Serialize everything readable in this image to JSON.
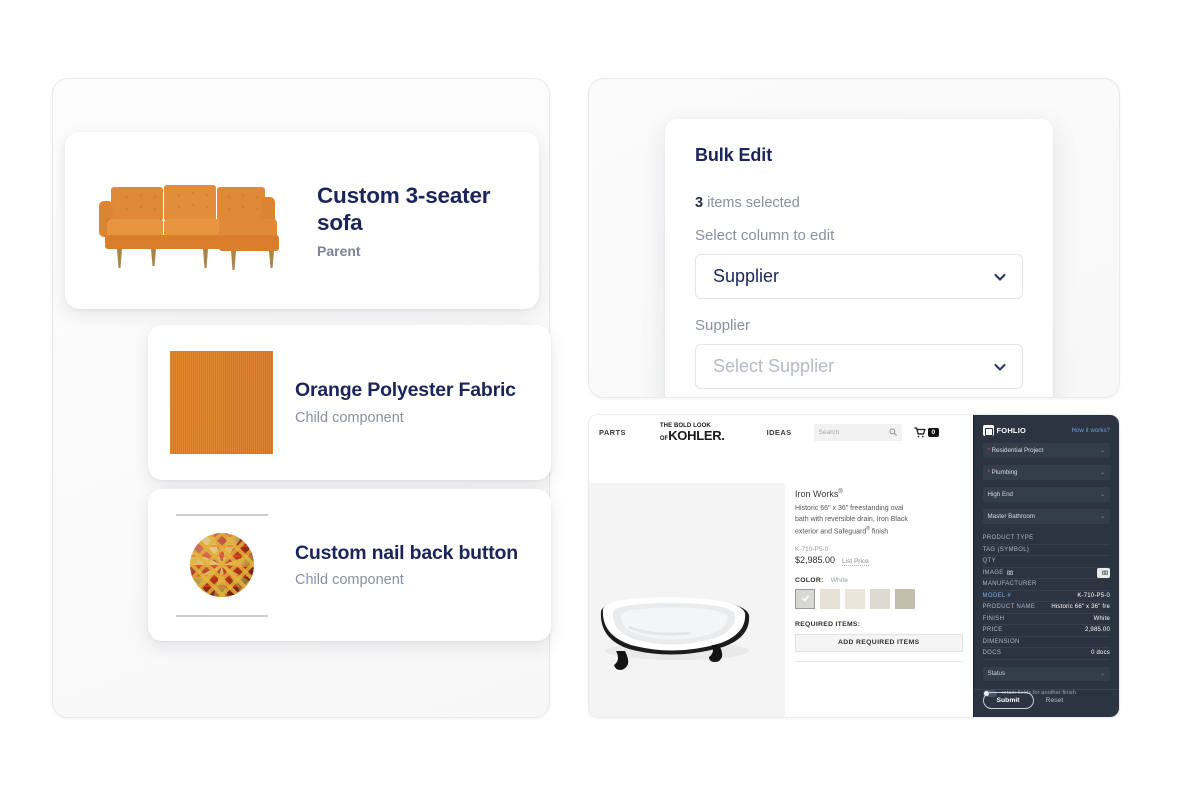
{
  "left_panel": {
    "cards": [
      {
        "title": "Custom 3-seater sofa",
        "subtitle": "Parent",
        "thumb": "sofa-image"
      },
      {
        "title": "Orange Polyester Fabric",
        "subtitle": "Child component",
        "thumb": "orange-fabric-swatch"
      },
      {
        "title": "Custom nail back button",
        "subtitle": "Child component",
        "thumb": "nail-button-image"
      }
    ]
  },
  "bulk_edit": {
    "title": "Bulk Edit",
    "count": "3",
    "count_suffix": " items selected",
    "column_label": "Select column to edit",
    "column_value": "Supplier",
    "supplier_label": "Supplier",
    "supplier_placeholder": "Select Supplier",
    "chevron_icon": "chevron-down-icon"
  },
  "kohler_shot": {
    "nav": {
      "parts": "PARTS",
      "logo_line1": "THE BOLD LOOK",
      "logo_line2_prefix": "OF",
      "logo_line2_brand": "KOHLER.",
      "ideas": "IDEAS",
      "search_placeholder": "Search",
      "search_icon": "search-icon",
      "cart_icon": "cart-icon",
      "cart_count": "0"
    },
    "product": {
      "image": "freestanding-oval-bathtub",
      "name": "Iron Works",
      "name_sup": "®",
      "description_1": "Historic 66\" x 36\" freestanding oval",
      "description_2": "bath with reversible drain, Iron Black",
      "description_3_a": "exterior and Safeguard",
      "description_3_sup": "®",
      "description_3_b": " finish",
      "sku": "K-710-P5-0",
      "price": "$2,985.00",
      "price_note": "List Price",
      "color_label": "COLOR:",
      "color_value": "White",
      "swatches": [
        "#d8d8d4",
        "#e7e2d4",
        "#e9e6dc",
        "#dcdad1",
        "#c4bfad"
      ],
      "selected_swatch_index": 0,
      "check_icon": "check-icon",
      "required_label": "REQUIRED ITEMS:",
      "add_button": "ADD REQUIRED ITEMS"
    },
    "fohlio": {
      "brand": "FOHLIO",
      "brand_icon": "fohlio-cube-icon",
      "how_it_works": "How it works?",
      "selects": [
        {
          "label": "Residential Project",
          "required": true
        },
        {
          "label": "Plumbing",
          "required": true
        },
        {
          "label": "High End",
          "required": false
        },
        {
          "label": "Master Bathroom",
          "required": false
        }
      ],
      "fields": [
        {
          "key": "PRODUCT TYPE",
          "value": ""
        },
        {
          "key": "TAG (SYMBOL)",
          "value": ""
        },
        {
          "key": "QTY",
          "value": ""
        },
        {
          "key": "IMAGE",
          "value": "",
          "icon": "camera-icon",
          "chip": true
        },
        {
          "key": "MANUFACTURER",
          "value": ""
        },
        {
          "key": "MODEL #",
          "value": "K-710-P5-0",
          "highlight": true
        },
        {
          "key": "PRODUCT NAME",
          "value": "Historic 66\" x 36\" fre"
        },
        {
          "key": "FINISH",
          "value": "White"
        },
        {
          "key": "PRICE",
          "value": "2,985.00"
        },
        {
          "key": "DIMENSION",
          "value": ""
        },
        {
          "key": "DOCS",
          "value": "0 docs"
        }
      ],
      "status_placeholder": "Status",
      "retain_toggle_label": "retain fields for another finish",
      "submit": "Submit",
      "reset": "Reset"
    }
  }
}
